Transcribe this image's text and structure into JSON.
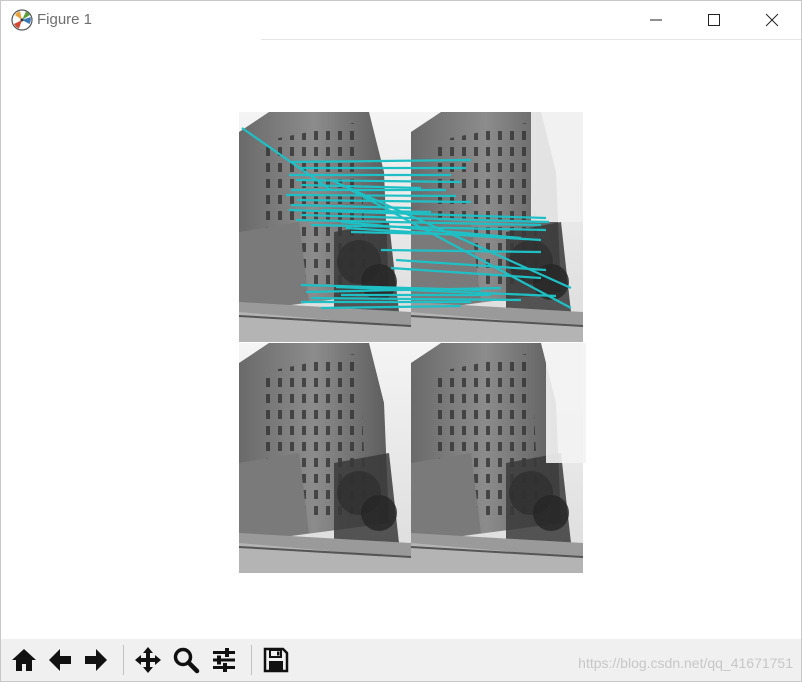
{
  "window": {
    "title": "Figure 1"
  },
  "toolbar": {
    "buttons": [
      {
        "name": "home",
        "icon": "home-icon"
      },
      {
        "name": "back",
        "icon": "arrow-left-icon"
      },
      {
        "name": "forward",
        "icon": "arrow-right-icon"
      },
      {
        "name": "pan",
        "icon": "move-icon"
      },
      {
        "name": "zoom",
        "icon": "magnifier-icon"
      },
      {
        "name": "configure-subplots",
        "icon": "sliders-icon"
      },
      {
        "name": "save",
        "icon": "floppy-disk-icon"
      }
    ],
    "watermark": "https://blog.csdn.net/qq_41671751"
  },
  "colors": {
    "match_line": "#1fc0c5",
    "toolbar_bg": "#f0f0f0",
    "title_text": "#6e6e6e"
  },
  "figure": {
    "panels": [
      {
        "name": "top-left",
        "content": "building photo (grayscale, query)"
      },
      {
        "name": "top-right",
        "content": "building photo (grayscale, rotated/cropped)"
      },
      {
        "name": "bottom-left",
        "content": "building photo (grayscale)"
      },
      {
        "name": "bottom-right",
        "content": "building photo (grayscale)"
      }
    ]
  }
}
